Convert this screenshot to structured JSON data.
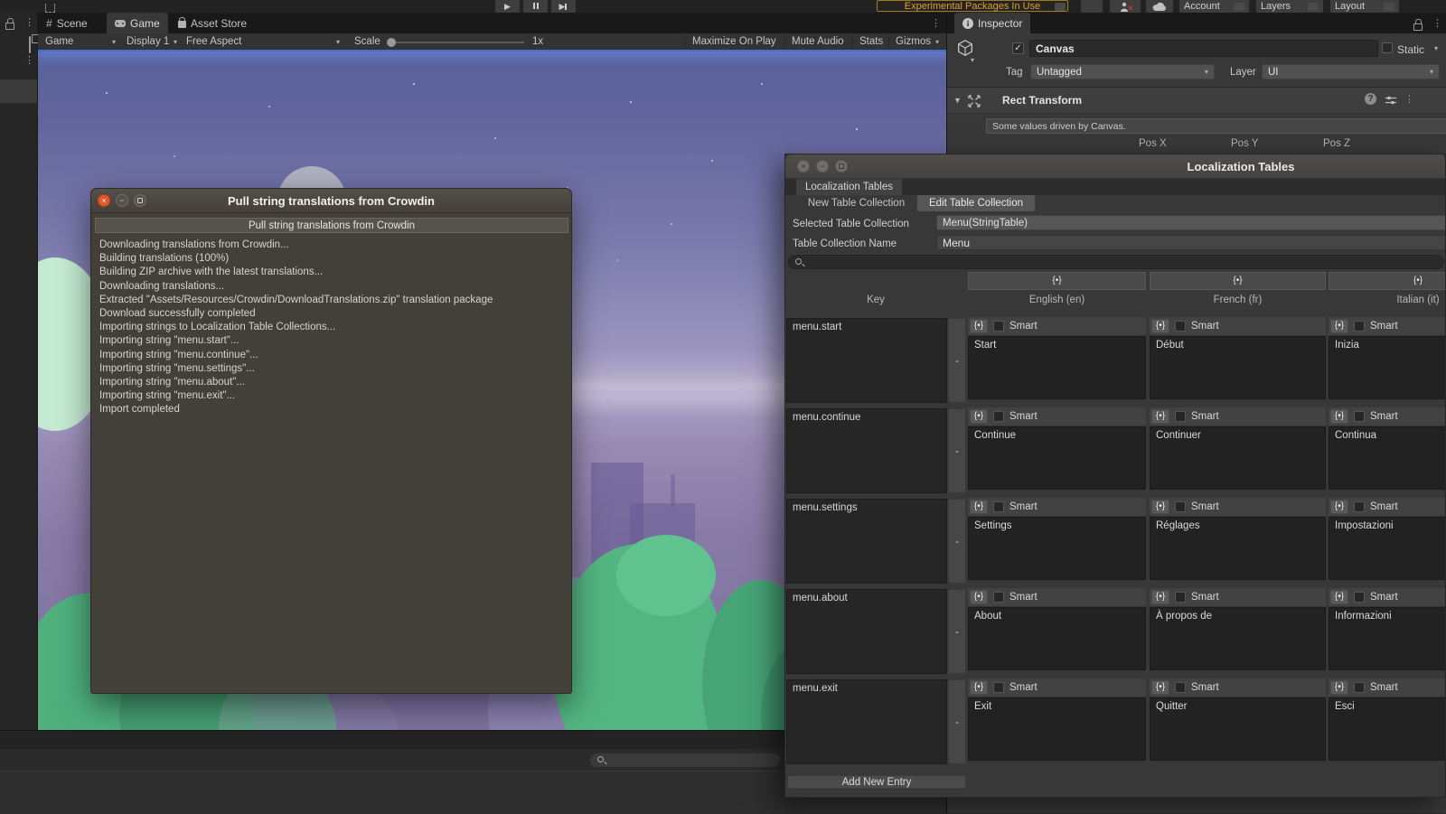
{
  "colors": {
    "warning_orange": "#d9a13c",
    "focus_blue": "#4a6fc6",
    "dialog_close_red": "#e0582c",
    "panel_gray": "#383838",
    "scene_sky_top": "#5d78c4",
    "scene_ground": "#7d719f",
    "scene_bush_green": "#53b582"
  },
  "top_bar": {
    "experimental_warning": "Experimental Packages In Use",
    "account_label": "Account",
    "layers_label": "Layers",
    "layout_label": "Layout"
  },
  "panel_tabs": {
    "scene": "Scene",
    "game": "Game",
    "asset_store": "Asset Store",
    "inspector": "Inspector"
  },
  "game_toolbar": {
    "game_dropdown": "Game",
    "display_dropdown": "Display 1",
    "aspect_dropdown": "Free Aspect",
    "scale_label": "Scale",
    "scale_value": "1x",
    "maximize_on_play": "Maximize On Play",
    "mute_audio": "Mute Audio",
    "stats": "Stats",
    "gizmos": "Gizmos"
  },
  "inspector": {
    "object_name": "Canvas",
    "static_label": "Static",
    "tag_label": "Tag",
    "tag_value": "Untagged",
    "layer_label": "Layer",
    "layer_value": "UI",
    "component_title": "Rect Transform",
    "help_text": "Some values driven by Canvas.",
    "pos_x": "Pos X",
    "pos_y": "Pos Y",
    "pos_z": "Pos Z"
  },
  "dialog": {
    "window_title": "Pull string translations from Crowdin",
    "header_button": "Pull string translations from Crowdin",
    "log_lines": [
      "Downloading translations from Crowdin...",
      "Building translations (100%)",
      "Building ZIP archive with the latest translations...",
      "Downloading translations...",
      "Extracted \"Assets/Resources/Crowdin/DownloadTranslations.zip\" translation package",
      "Download successfully completed",
      "Importing strings to Localization Table Collections...",
      "Importing string \"menu.start\"...",
      "Importing string \"menu.continue\"...",
      "Importing string \"menu.settings\"...",
      "Importing string \"menu.about\"...",
      "Importing string \"menu.exit\"...",
      "Import completed"
    ]
  },
  "loc_tables": {
    "window_title": "Localization Tables",
    "tab_label": "Localization Tables",
    "new_table_button": "New Table Collection",
    "edit_table_button": "Edit Table Collection",
    "selected_label": "Selected Table Collection",
    "selected_value": "Menu(StringTable)",
    "name_label": "Table Collection Name",
    "name_value": "Menu",
    "key_column": "Key",
    "language_columns": [
      "English (en)",
      "French (fr)",
      "Italian (it)"
    ],
    "smart_label": "Smart",
    "remove_button": "-",
    "add_entry_button": "Add New Entry",
    "entries": [
      {
        "key": "menu.start",
        "translations": [
          "Start",
          "Début",
          "Inizia"
        ]
      },
      {
        "key": "menu.continue",
        "translations": [
          "Continue",
          "Continuer",
          "Continua"
        ]
      },
      {
        "key": "menu.settings",
        "translations": [
          "Settings",
          "Réglages",
          "Impostazioni"
        ]
      },
      {
        "key": "menu.about",
        "translations": [
          "About",
          "À propos de",
          "Informazioni"
        ]
      },
      {
        "key": "menu.exit",
        "translations": [
          "Exit",
          "Quitter",
          "Esci"
        ]
      }
    ]
  }
}
